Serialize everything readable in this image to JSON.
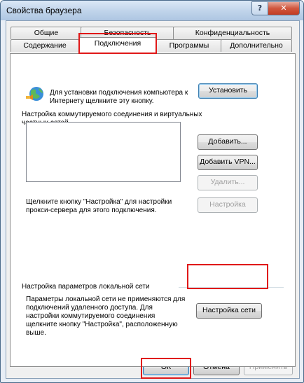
{
  "window": {
    "title": "Свойства браузера",
    "help_label": "?",
    "close_label": "✕"
  },
  "tabs": {
    "row1": [
      {
        "label": "Общие"
      },
      {
        "label": "Безопасность"
      },
      {
        "label": "Конфиденциальность"
      }
    ],
    "row2": [
      {
        "label": "Содержание"
      },
      {
        "label": "Подключения"
      },
      {
        "label": "Программы"
      },
      {
        "label": "Дополнительно"
      }
    ]
  },
  "connections": {
    "setup_text": "Для установки подключения компьютера к Интернету щелкните эту кнопку.",
    "setup_button": "Установить",
    "dialup_heading": "Настройка коммутируемого соединения и виртуальных частных сетей",
    "add_button": "Добавить...",
    "add_vpn_button": "Добавить VPN...",
    "remove_button": "Удалить...",
    "proxy_text": "Щелкните кнопку \"Настройка\" для настройки прокси-сервера для этого подключения.",
    "settings_button": "Настройка",
    "lan_heading": "Настройка параметров локальной сети",
    "lan_text": "Параметры локальной сети не применяются для подключений удаленного доступа. Для настройки коммутируемого соединения щелкните кнопку \"Настройка\", расположенную выше.",
    "lan_button": "Настройка сети"
  },
  "footer": {
    "ok": "ОК",
    "cancel": "Отмена",
    "apply": "Применить"
  },
  "colors": {
    "highlight": "#e01818",
    "title_gradient": "#bfd3ea"
  }
}
